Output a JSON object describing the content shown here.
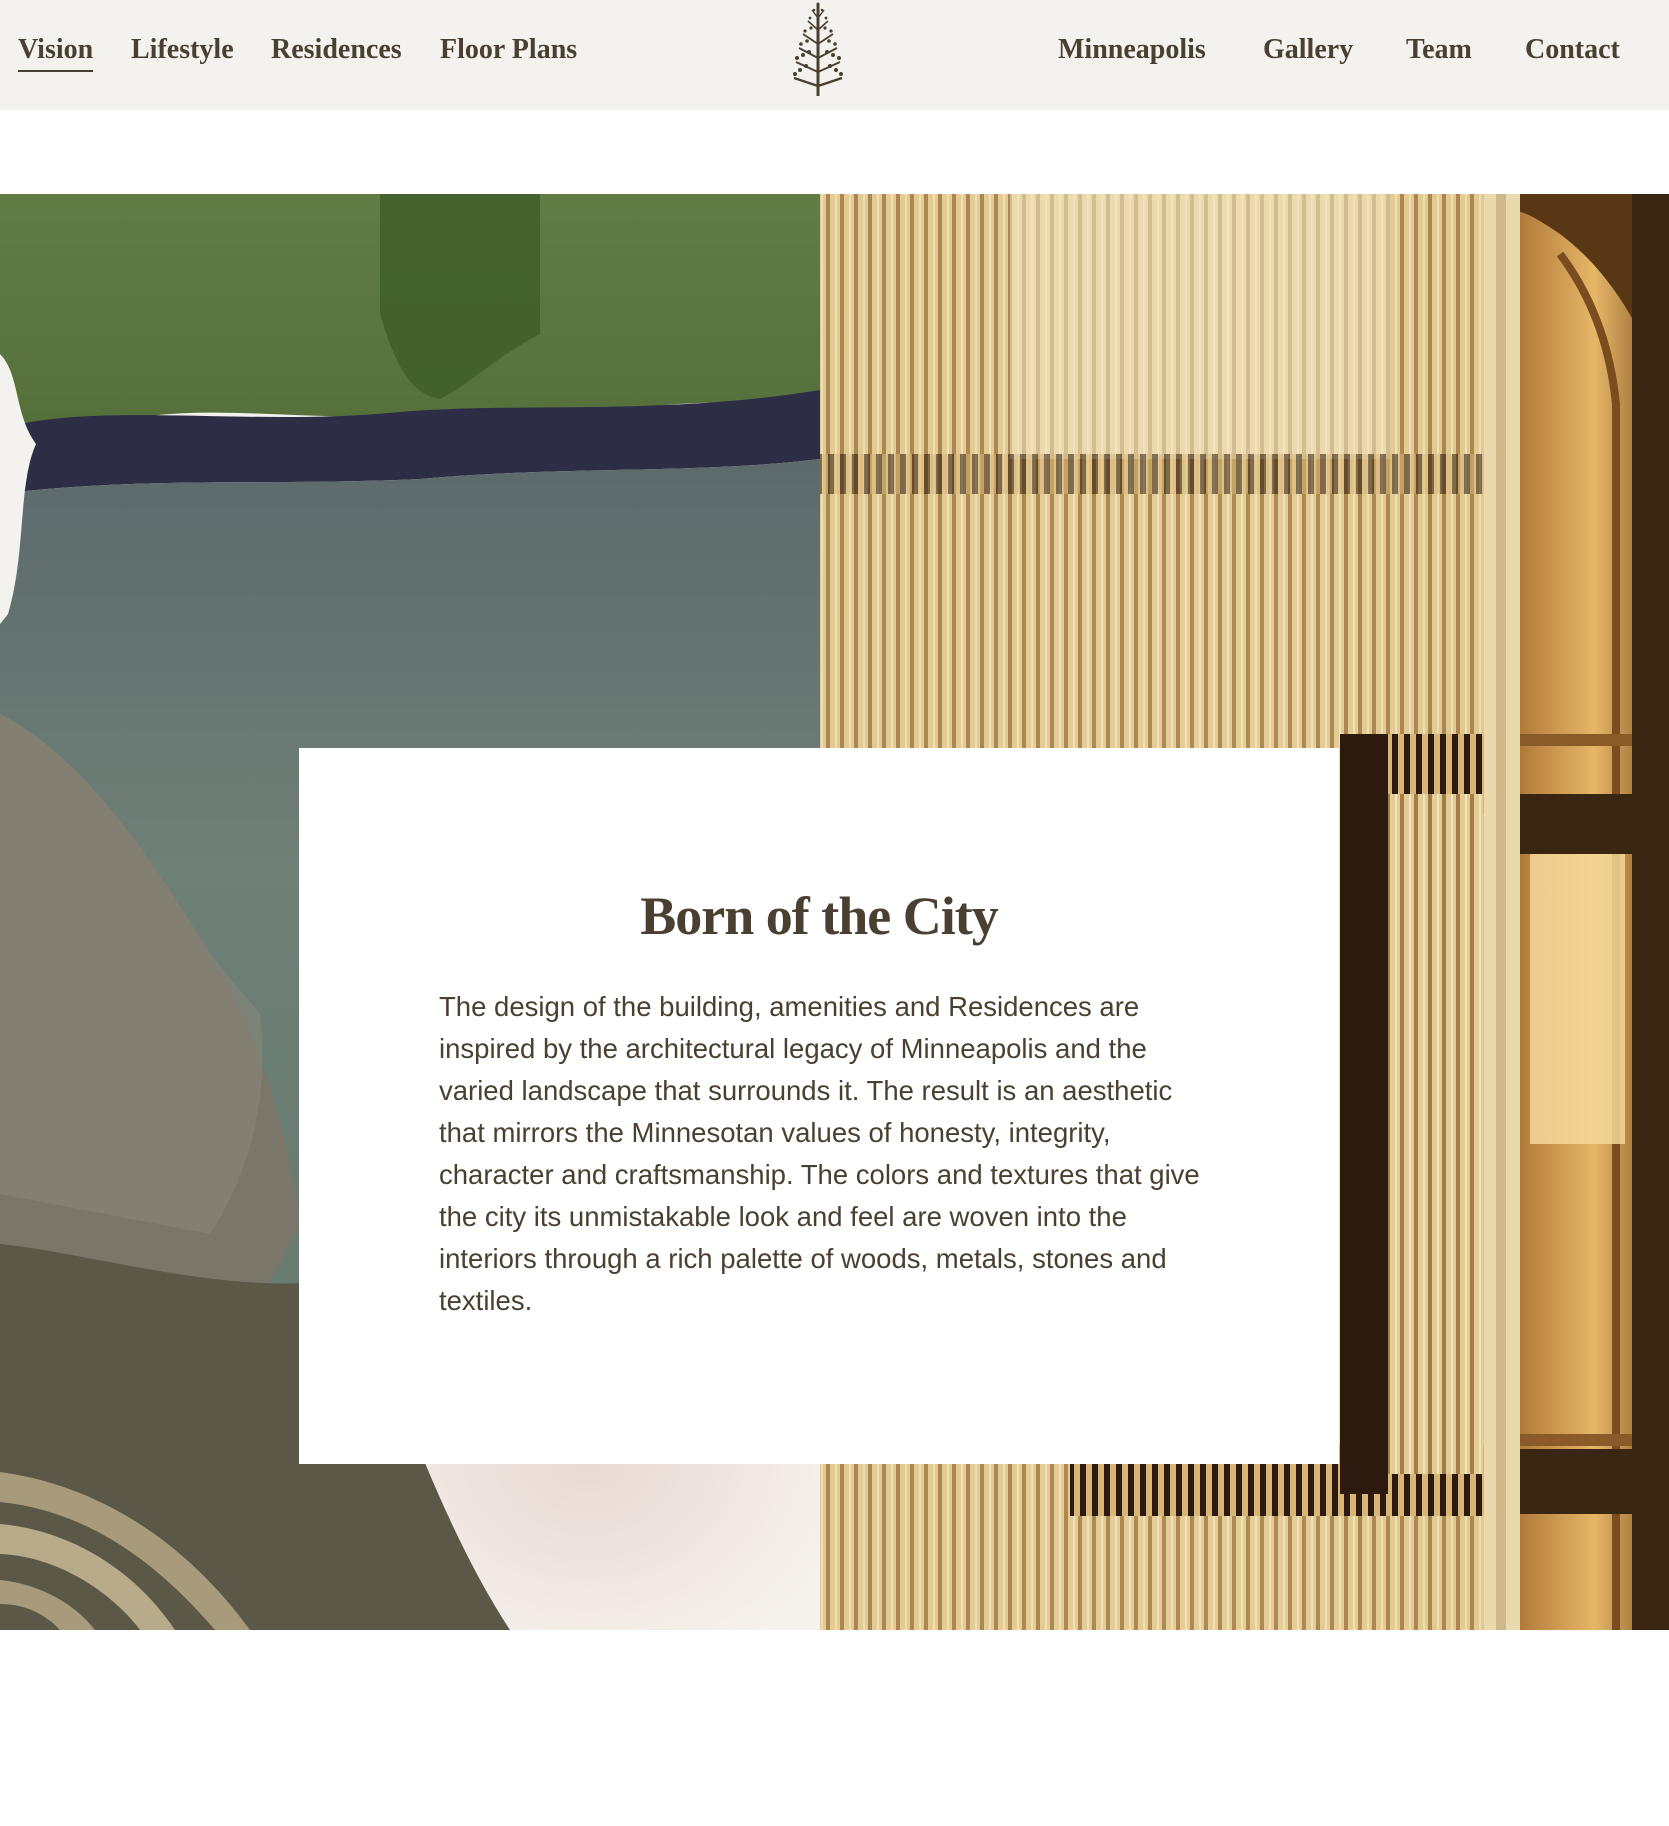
{
  "nav": {
    "left_items": [
      {
        "label": "Vision",
        "active": true
      },
      {
        "label": "Lifestyle"
      },
      {
        "label": "Residences"
      },
      {
        "label": "Floor Plans"
      }
    ],
    "right_items": [
      {
        "label": "Minneapolis"
      },
      {
        "label": "Gallery"
      },
      {
        "label": "Team"
      },
      {
        "label": "Contact"
      }
    ],
    "logo_icon": "tree-logo-icon"
  },
  "card": {
    "title": "Born of the City",
    "body": "The design of the building, amenities and Residences are inspired by the architectural legacy of Minneapolis and the varied landscape that surrounds it. The result is an aesthetic that mirrors the Minnesotan values of honesty, integrity, character and craftsmanship. The colors and textures that give the city its unmistakable look and feel are woven into the interiors through a rich palette of woods, metals, stones and textiles."
  },
  "colors": {
    "nav_bg": "#f4f2ef",
    "text": "#4a4032",
    "moss_green": "#5f7a45",
    "slate_green": "#6b7f78",
    "olive_gray": "#5c5848",
    "wood_light": "#e6cf9a",
    "wood_dark": "#3a2412"
  }
}
